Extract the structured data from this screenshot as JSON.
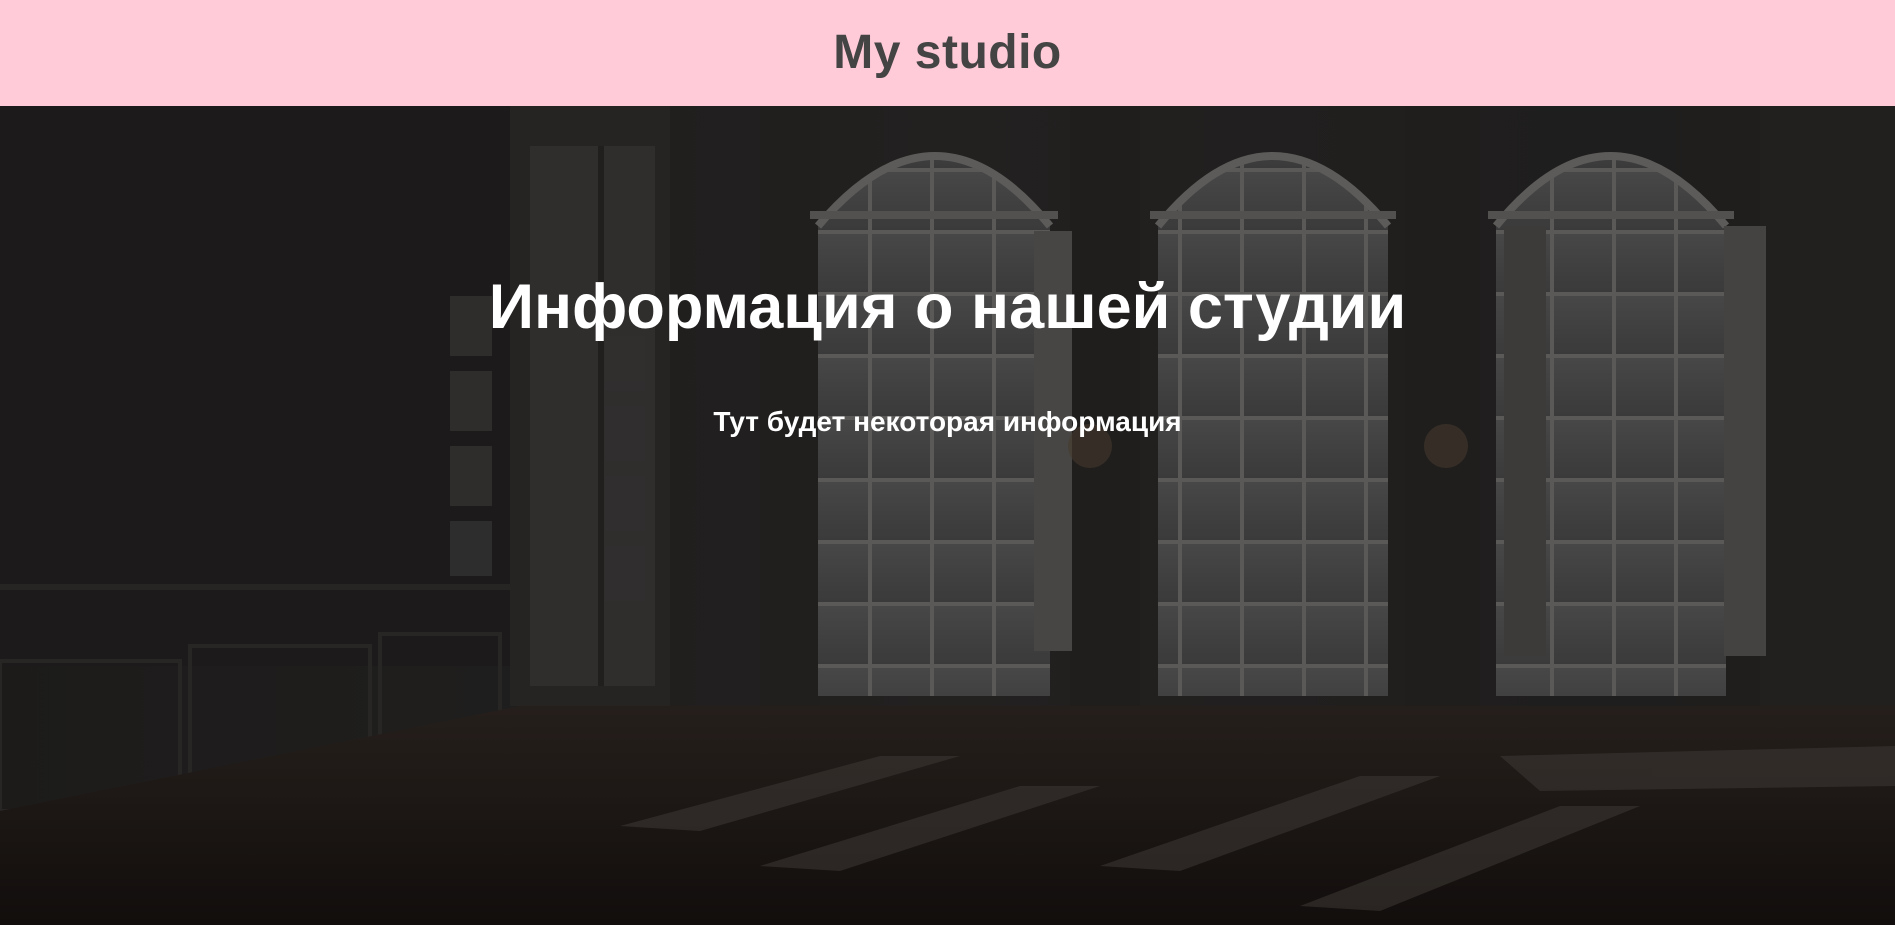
{
  "header": {
    "brand": "My studio",
    "background_color": "#ffcbd8",
    "text_color": "#444444"
  },
  "hero": {
    "title": "Информация о нашей студии",
    "subtitle": "Тут будет некоторая информация",
    "background_image": "dark-ballroom-interior-with-arched-windows",
    "text_color": "#ffffff"
  }
}
